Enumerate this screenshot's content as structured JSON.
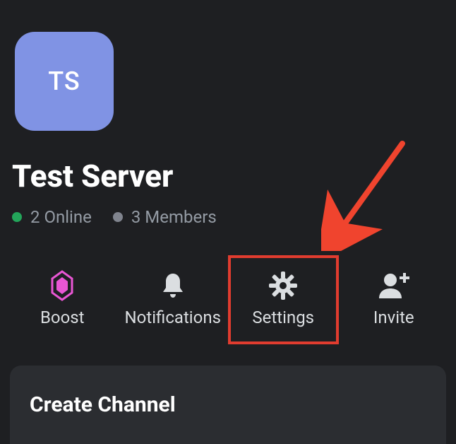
{
  "server": {
    "avatar_initials": "TS",
    "name": "Test Server",
    "online_text": "2 Online",
    "members_text": "3 Members"
  },
  "actions": {
    "boost": "Boost",
    "notifications": "Notifications",
    "settings": "Settings",
    "invite": "Invite"
  },
  "create_channel": "Create Channel",
  "colors": {
    "avatar_bg": "#8093e4",
    "highlight": "#e13c2f",
    "online": "#23a55a"
  }
}
